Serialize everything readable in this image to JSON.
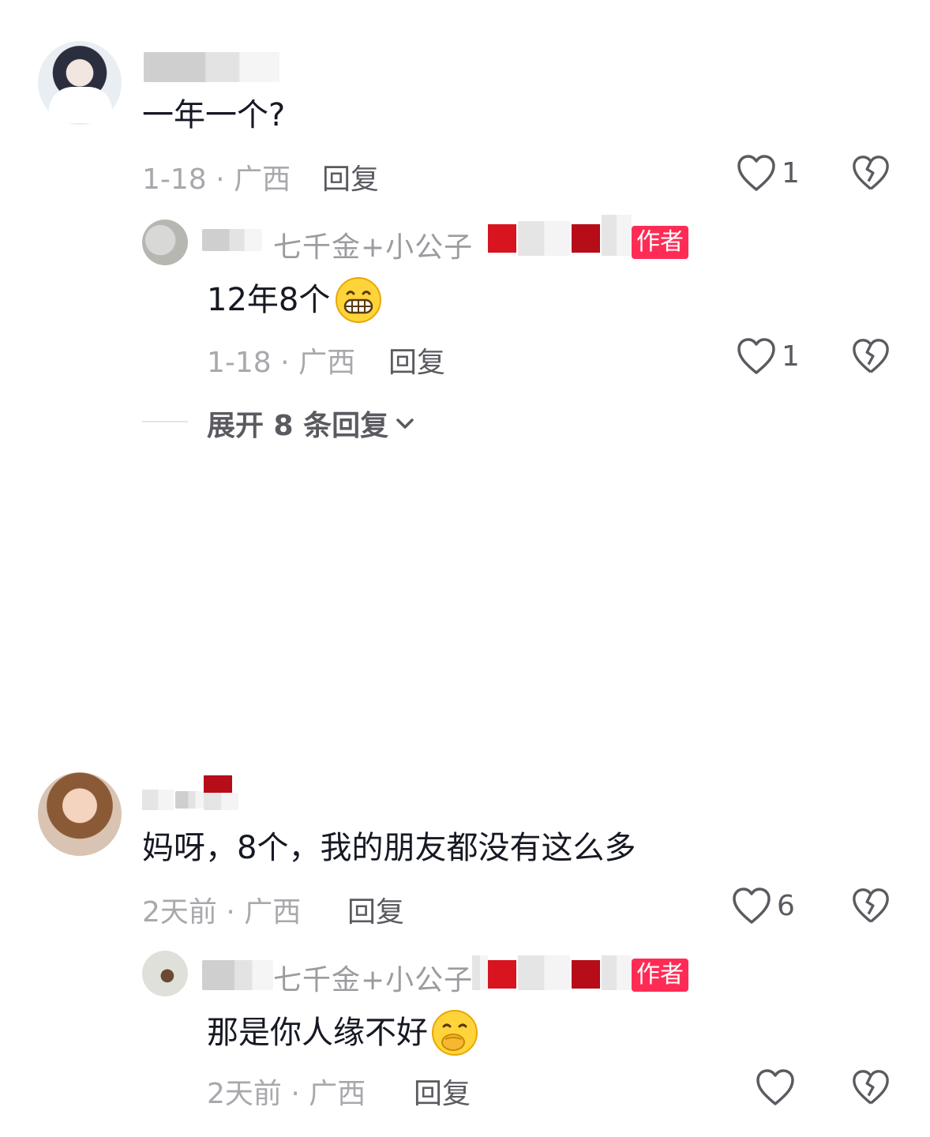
{
  "comments": [
    {
      "text": "一年一个?",
      "time": "1-18",
      "location": "广西",
      "reply_label": "回复",
      "likes": "1",
      "replies": [
        {
          "name": "七千金+小公子",
          "badge": "作者",
          "text": "12年8个",
          "emoji": "grinning-face-emoji",
          "time": "1-18",
          "location": "广西",
          "reply_label": "回复",
          "likes": "1"
        }
      ],
      "expand_label": "展开 8 条回复"
    },
    {
      "text": "妈呀，8个，我的朋友都没有这么多",
      "time": "2天前",
      "location": "广西",
      "reply_label": "回复",
      "likes": "6",
      "replies": [
        {
          "name": "七千金+小公子",
          "badge": "作者",
          "text": "那是你人缘不好",
          "emoji": "face-with-hand-over-mouth-emoji",
          "time": "2天前",
          "location": "广西",
          "reply_label": "回复",
          "likes": ""
        }
      ]
    }
  ],
  "separator": "·",
  "colors": {
    "badge": "#fe2c55",
    "meta": "#a8a8ad",
    "text": "#161823"
  }
}
